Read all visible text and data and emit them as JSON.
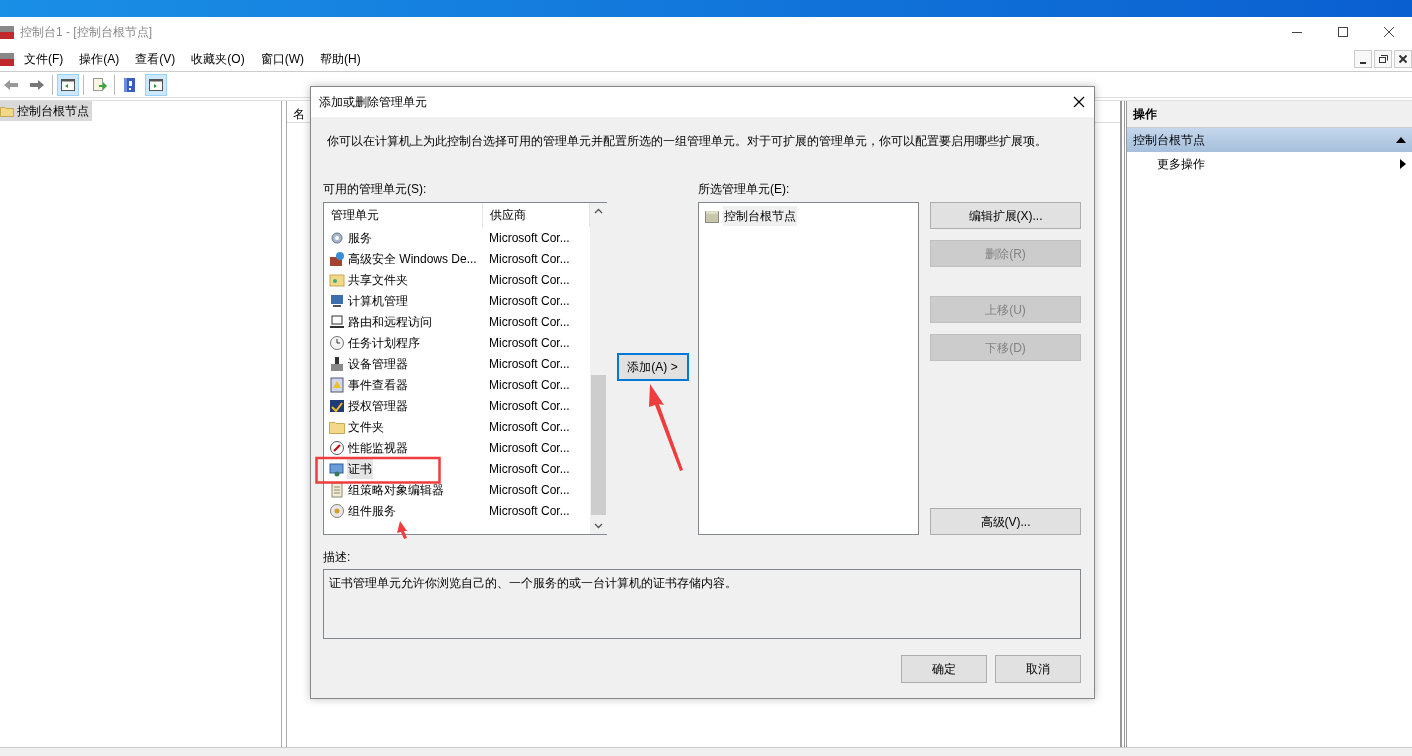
{
  "window": {
    "title": "控制台1 - [控制台根节点]"
  },
  "menu": [
    {
      "label": "文件(F)"
    },
    {
      "label": "操作(A)"
    },
    {
      "label": "查看(V)"
    },
    {
      "label": "收藏夹(O)"
    },
    {
      "label": "窗口(W)"
    },
    {
      "label": "帮助(H)"
    }
  ],
  "toolbar": [
    {
      "pressed": false
    },
    {
      "pressed": false
    },
    {
      "pressed": true
    },
    {
      "pressed": false
    },
    {
      "pressed": false
    },
    {
      "pressed": true
    }
  ],
  "tree": {
    "items": [
      {
        "label": "控制台根节点",
        "selected": true
      }
    ]
  },
  "center": {
    "column_1": "名"
  },
  "actions": {
    "title": "操作",
    "section": {
      "label": "控制台根节点",
      "expanded": true
    },
    "items": [
      {
        "label": "更多操作"
      }
    ]
  },
  "dialog": {
    "title": "添加或删除管理单元",
    "intro": "你可以在计算机上为此控制台选择可用的管理单元并配置所选的一组管理单元。对于可扩展的管理单元，你可以配置要启用哪些扩展项。",
    "available_label": "可用的管理单元(S):",
    "columns": [
      "管理单元",
      "供应商"
    ],
    "snapins": [
      {
        "name": "服务",
        "vendor": "Microsoft Cor...",
        "selected": false
      },
      {
        "name": "高级安全 Windows De...",
        "vendor": "Microsoft Cor...",
        "selected": false
      },
      {
        "name": "共享文件夹",
        "vendor": "Microsoft Cor...",
        "selected": false
      },
      {
        "name": "计算机管理",
        "vendor": "Microsoft Cor...",
        "selected": false
      },
      {
        "name": "路由和远程访问",
        "vendor": "Microsoft Cor...",
        "selected": false
      },
      {
        "name": "任务计划程序",
        "vendor": "Microsoft Cor...",
        "selected": false
      },
      {
        "name": "设备管理器",
        "vendor": "Microsoft Cor...",
        "selected": false
      },
      {
        "name": "事件查看器",
        "vendor": "Microsoft Cor...",
        "selected": false
      },
      {
        "name": "授权管理器",
        "vendor": "Microsoft Cor...",
        "selected": false
      },
      {
        "name": "文件夹",
        "vendor": "Microsoft Cor...",
        "selected": false
      },
      {
        "name": "性能监视器",
        "vendor": "Microsoft Cor...",
        "selected": false
      },
      {
        "name": "证书",
        "vendor": "Microsoft Cor...",
        "selected": true
      },
      {
        "name": "组策略对象编辑器",
        "vendor": "Microsoft Cor...",
        "selected": false
      },
      {
        "name": "组件服务",
        "vendor": "Microsoft Cor...",
        "selected": false
      }
    ],
    "add_button": {
      "label": "添加(A) >",
      "focused": true
    },
    "selected_label": "所选管理单元(E):",
    "selected_items": [
      {
        "label": "控制台根节点"
      }
    ],
    "side_buttons": [
      {
        "label": "编辑扩展(X)...",
        "disabled": false
      },
      {
        "label": "删除(R)",
        "disabled": true
      },
      {
        "label": "上移(U)",
        "disabled": true
      },
      {
        "label": "下移(D)",
        "disabled": true
      },
      {
        "label": "高级(V)...",
        "disabled": false
      }
    ],
    "description_label": "描述:",
    "description": "证书管理单元允许你浏览自己的、一个服务的或一台计算机的证书存储内容。",
    "buttons": [
      {
        "label": "确定"
      },
      {
        "label": "取消"
      }
    ]
  }
}
